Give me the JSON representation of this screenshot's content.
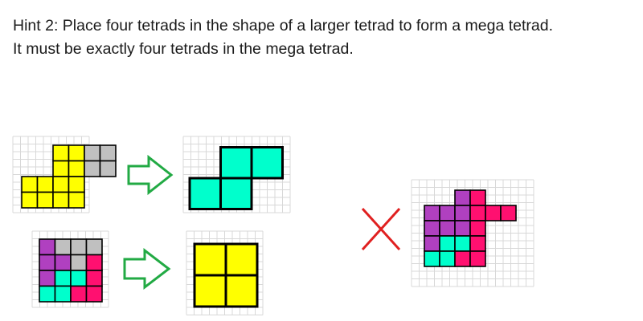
{
  "hint": {
    "line1": "Hint 2: Place four tetrads in the shape of a larger tetrad to form a mega tetrad.",
    "line2": "It must be exactly four tetrads in the mega tetrad."
  },
  "colors": {
    "yellow": "#ffff00",
    "gray": "#c0c0c0",
    "teal": "#00ffcc",
    "purple": "#b040c0",
    "pink": "#ff1070",
    "arrow": "#22aa44",
    "cross": "#e02020",
    "grid": "#d8d8d8"
  },
  "figures": {
    "s_shape_small_grid": "yellow-and-gray-cells",
    "s_shape_mega": "teal-mega-s-tetrad",
    "square_small_grid": "purple-gray-teal-pink-cells",
    "square_mega": "yellow-mega-square-tetrad",
    "invalid_example": "five-tetrad-mixed-shape",
    "arrow_icon": "arrow-right-outline-icon",
    "cross_icon": "red-x-icon"
  }
}
